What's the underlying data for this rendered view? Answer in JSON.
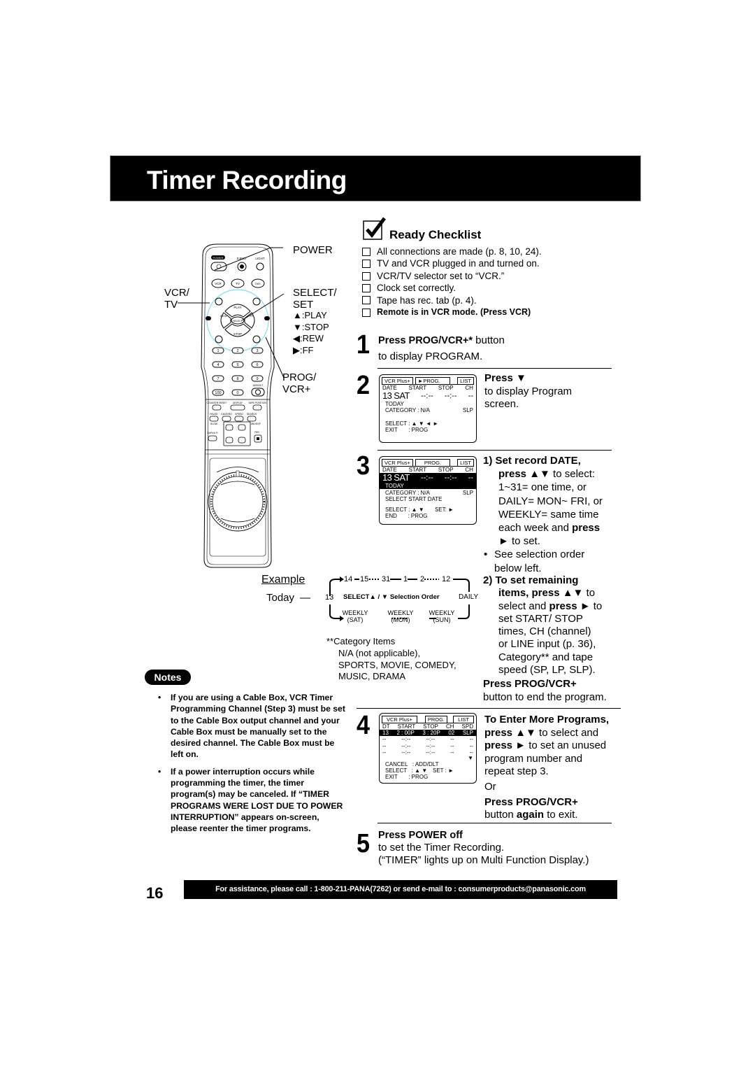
{
  "title": "Timer Recording",
  "ready_checklist": {
    "heading": "Ready Checklist",
    "items": [
      {
        "text": "All connections are made (p. 8, 10, 24).",
        "bold": false
      },
      {
        "text": "TV and VCR plugged in and turned on.",
        "bold": false
      },
      {
        "text": "VCR/TV selector set to “VCR.”",
        "bold": false
      },
      {
        "text": "Clock set correctly.",
        "bold": false
      },
      {
        "text": "Tape has rec. tab (p. 4).",
        "bold": false
      },
      {
        "text": "Remote is in VCR mode. (Press VCR)",
        "bold": true
      }
    ]
  },
  "remote": {
    "labels": {
      "power": "POWER",
      "vcr_tv_1": "VCR/",
      "vcr_tv_2": "TV",
      "select_1": "SELECT/",
      "select_2": "SET",
      "play": ":PLAY",
      "stop": ":STOP",
      "rew": ":REW",
      "ff": ":FF",
      "prog_1": "PROG/",
      "prog_2": "VCR+"
    },
    "buttons": {
      "power": "POWER",
      "eject": "EJECT",
      "light": "LIGHT",
      "vcr": "VCR",
      "tv": "TV",
      "dss": "DSS/CABLE",
      "play": "PLAY",
      "stop": "STOP",
      "rew": "REW",
      "ff": "FF",
      "select": "SELECT",
      "set": "SET",
      "action": "ACTION",
      "numbers": [
        "1",
        "2",
        "3",
        "4",
        "5",
        "6",
        "7",
        "8",
        "9",
        "100",
        "0"
      ],
      "add_dlt": "ADD/DLT",
      "counter_reset": "COUNTER RESET",
      "display": "DISPLAY",
      "tape_position": "TAPE POSITION",
      "pause": "PAUSE",
      "slow": "SLOW",
      "cm_zero": "CM/ZERO",
      "speed": "SPEED",
      "search": "SEARCH",
      "ma_skip": "MA SKIP",
      "sap_hifi": "SAP/HI-FI",
      "vol": "VOL",
      "ch": "CH",
      "rec": "REC"
    }
  },
  "steps": {
    "s1": {
      "num": "1",
      "bold": "Press PROG/VCR+*",
      "rest": " button",
      "line2": "to display PROGRAM."
    },
    "s2": {
      "num": "2",
      "bold": "Press ▼",
      "line2": "to display Program",
      "line3": "screen.",
      "osd": {
        "tabs": [
          "VCR Plus+",
          "►PROG.",
          "LIST"
        ],
        "header": [
          "DATE",
          "START",
          "STOP",
          "CH"
        ],
        "big_row": [
          "13 SAT",
          "--:--",
          "--:--",
          "--"
        ],
        "today": "TODAY",
        "category": "CATEGORY : N/A",
        "speed": "SLP",
        "select": "SELECT : ▲ ▼ ◄ ►",
        "exit": "EXIT       : PROG"
      }
    },
    "s3": {
      "num": "3",
      "p1_bold": "1)  Set record DATE,",
      "p1_l2_bold": "press ▲▼",
      "p1_l2_rest": " to select:",
      "p1_l3": "1~31= one time, or",
      "p1_l4": "DAILY= MON~ FRI, or",
      "p1_l5": "WEEKLY= same time",
      "p1_l6_a": "each week and ",
      "p1_l6_b": "press",
      "p1_l7": "► to set.",
      "bullet_1": "See selection order",
      "bullet_2": "below left.",
      "p2_l1": "2)  To set remaining",
      "p2_l2_bold": "items, press ▲▼",
      "p2_l2_rest": " to",
      "p2_l3_a": "select and ",
      "p2_l3_b": "press ►",
      "p2_l3_c": " to",
      "p2_l4": "set START/ STOP",
      "p2_l5": "times, CH (channel)",
      "p2_l6": "or LINE input (p. 36),",
      "p2_l7": "Category** and tape",
      "p2_l8": "speed (SP, LP, SLP).",
      "end_bold": "Press PROG/VCR+",
      "end_rest": "button to end the program.",
      "osd": {
        "tabs": [
          "VCR Plus+",
          "PROG.",
          "LIST"
        ],
        "header": [
          "DATE",
          "START",
          "STOP",
          "CH"
        ],
        "big_row": [
          "13 SAT",
          "--:--",
          "--:--",
          "--"
        ],
        "today": "TODAY",
        "category": "CATEGORY : N/A",
        "speed": "SLP",
        "hint": "SELECT START DATE",
        "select": "SELECT : ▲ ▼",
        "set": "SET: ►",
        "end": "END       : PROG"
      }
    },
    "s4": {
      "num": "4",
      "l1": "To Enter More Programs,",
      "l2_bold": "press ▲▼",
      "l2_rest": " to select and",
      "l3_bold": "press ►",
      "l3_rest": " to set an unused",
      "l4": "program number and",
      "l5": "repeat step 3.",
      "or": "Or",
      "l6_bold": "Press PROG/VCR+",
      "l7_a": "button ",
      "l7_b": "again",
      "l7_c": " to exit.",
      "osd": {
        "tabs": [
          "VCR Plus+",
          "PROG.",
          "LIST"
        ],
        "header": [
          "DT",
          "START",
          "STOP",
          "CH",
          "SPD"
        ],
        "rows": [
          [
            "13",
            "2 : 00P",
            "3 : 20P",
            "02",
            "SLP"
          ],
          [
            "--",
            "--:--",
            "--:--",
            "--",
            "--"
          ],
          [
            "--",
            "--:--",
            "--:--",
            "--",
            "--"
          ],
          [
            "--",
            "--:--",
            "--:--",
            "--",
            "--"
          ]
        ],
        "more": "▼",
        "cancel": "CANCEL   : ADD/DLT",
        "select": "SELECT   : ▲ ▼",
        "set": "SET : ►",
        "exit": "EXIT       : PROG"
      }
    },
    "s5": {
      "num": "5",
      "bold": "Press POWER off",
      "line2": "to set the Timer Recording.",
      "line3": "(“TIMER” lights up on Multi Function Display.)"
    }
  },
  "example": {
    "heading": "Example",
    "today": "Today",
    "start": "13",
    "top_seq": [
      "14",
      "15",
      "31",
      "1",
      "2",
      "12"
    ],
    "center": "SELECT▲ / ▼ Selection Order",
    "daily": "DAILY",
    "weekly": [
      {
        "label": "WEEKLY",
        "day": "(SAT)"
      },
      {
        "label": "WEEKLY",
        "day": "(MON)"
      },
      {
        "label": "WEEKLY",
        "day": "(SUN)"
      }
    ]
  },
  "category_items": {
    "heading": "**Category Items",
    "lines": [
      "N/A (not applicable),",
      "SPORTS, MOVIE, COMEDY,",
      "MUSIC, DRAMA"
    ]
  },
  "notes": {
    "label": "Notes",
    "items": [
      "If you are using a Cable Box, VCR Timer Programming Channel (Step 3) must be set to the Cable Box output channel and your Cable Box must be manually set to the desired channel. The Cable Box must be left on.",
      "If a power interruption occurs while programming the timer, the timer program(s) may be canceled. If “TIMER PROGRAMS WERE LOST DUE TO POWER INTERRUPTION” appears on-screen, please reenter the timer programs."
    ]
  },
  "footer": {
    "page_number": "16",
    "assistance": "For assistance, please call : 1-800-211-PANA(7262) or send e-mail to : consumerproducts@panasonic.com"
  },
  "colors": {
    "banner": "#000000",
    "remote_ring": "#7fe0f0"
  }
}
